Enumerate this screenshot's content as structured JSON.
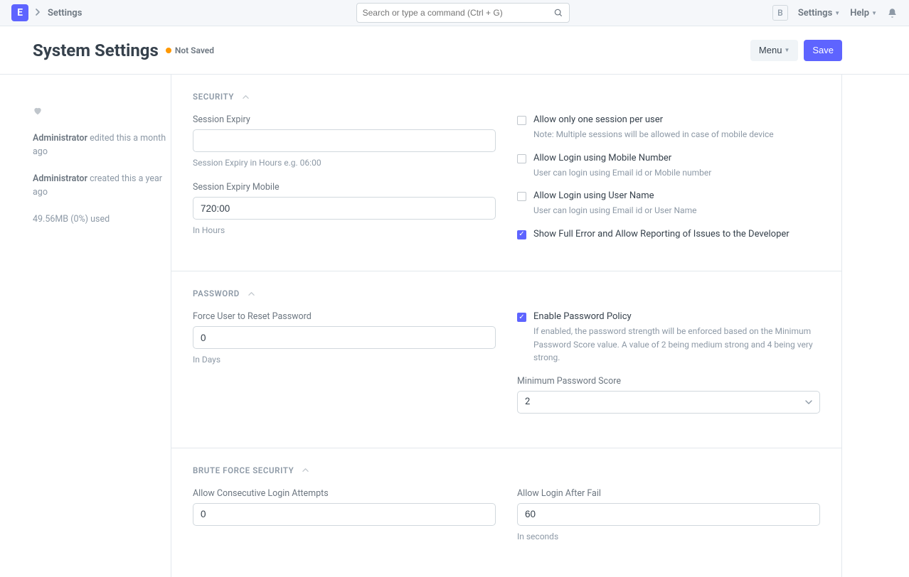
{
  "nav": {
    "logo_letter": "E",
    "breadcrumb": "Settings",
    "search_placeholder": "Search or type a command (Ctrl + G)",
    "user_badge": "B",
    "settings_link": "Settings",
    "help_link": "Help"
  },
  "header": {
    "title": "System Settings",
    "status": "Not Saved",
    "menu_button": "Menu",
    "save_button": "Save"
  },
  "sidebar": {
    "edited_by": "Administrator",
    "edited_text": " edited this a month ago",
    "created_by": "Administrator",
    "created_text": " created this a year ago",
    "storage": "49.56MB (0%) used"
  },
  "sections": {
    "security": {
      "title": "SECURITY",
      "session_expiry_label": "Session Expiry",
      "session_expiry_value": "",
      "session_expiry_help": "Session Expiry in Hours e.g. 06:00",
      "session_expiry_mobile_label": "Session Expiry Mobile",
      "session_expiry_mobile_value": "720:00",
      "session_expiry_mobile_help": "In Hours",
      "allow_one_session_label": "Allow only one session per user",
      "allow_one_session_help": "Note: Multiple sessions will be allowed in case of mobile device",
      "allow_mobile_login_label": "Allow Login using Mobile Number",
      "allow_mobile_login_help": "User can login using Email id or Mobile number",
      "allow_username_login_label": "Allow Login using User Name",
      "allow_username_login_help": "User can login using Email id or User Name",
      "show_full_error_label": "Show Full Error and Allow Reporting of Issues to the Developer"
    },
    "password": {
      "title": "PASSWORD",
      "force_reset_label": "Force User to Reset Password",
      "force_reset_value": "0",
      "force_reset_help": "In Days",
      "enable_policy_label": "Enable Password Policy",
      "enable_policy_help": "If enabled, the password strength will be enforced based on the Minimum Password Score value. A value of 2 being medium strong and 4 being very strong.",
      "min_score_label": "Minimum Password Score",
      "min_score_value": "2"
    },
    "brute": {
      "title": "BRUTE FORCE SECURITY",
      "attempts_label": "Allow Consecutive Login Attempts",
      "attempts_value": "0",
      "after_fail_label": "Allow Login After Fail",
      "after_fail_value": "60",
      "after_fail_help": "In seconds"
    }
  }
}
